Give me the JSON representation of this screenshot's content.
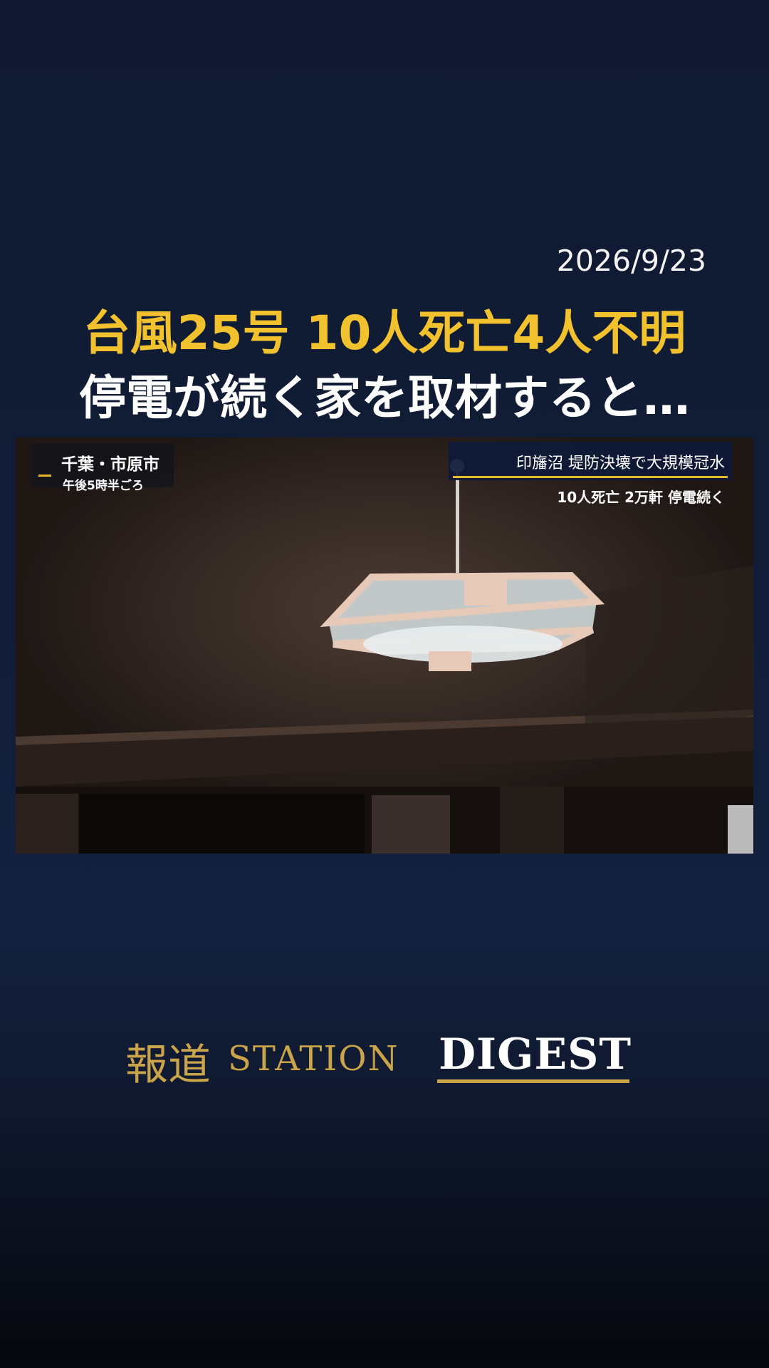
{
  "date": "2026/9/23",
  "headline": {
    "line1": "台風25号 10人死亡4人不明",
    "line2": "停電が続く家を取材すると…"
  },
  "video": {
    "location_main": "千葉・市原市",
    "location_sub": "午後5時半ごろ",
    "ticker_main": "印旛沼 堤防決壊で大規模冠水",
    "ticker_sub": "10人死亡 2万軒 停電続く"
  },
  "logo": {
    "jp": "報道",
    "station": "STATION",
    "digest": "DIGEST"
  },
  "colors": {
    "accent_gold": "#f2c22e",
    "logo_gold": "#c9a44a",
    "background_navy": "#111d38"
  }
}
